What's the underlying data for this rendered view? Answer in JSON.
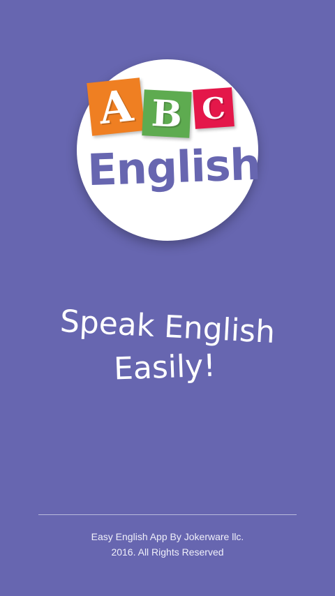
{
  "colors": {
    "background": "#6766b0",
    "logo_circle": "#ffffff",
    "block_a": "#ef7f22",
    "block_b": "#5eab50",
    "block_c": "#e4174a",
    "logo_text": "#6766b0",
    "text": "#ffffff"
  },
  "logo": {
    "letter_a": "A",
    "letter_b": "B",
    "letter_c": "C",
    "word": "English"
  },
  "tagline": {
    "line1": "Speak English",
    "line2": "Easily!"
  },
  "footer": {
    "line1": "Easy English App By Jokerware llc.",
    "line2": "2016. All Rights Reserved"
  }
}
